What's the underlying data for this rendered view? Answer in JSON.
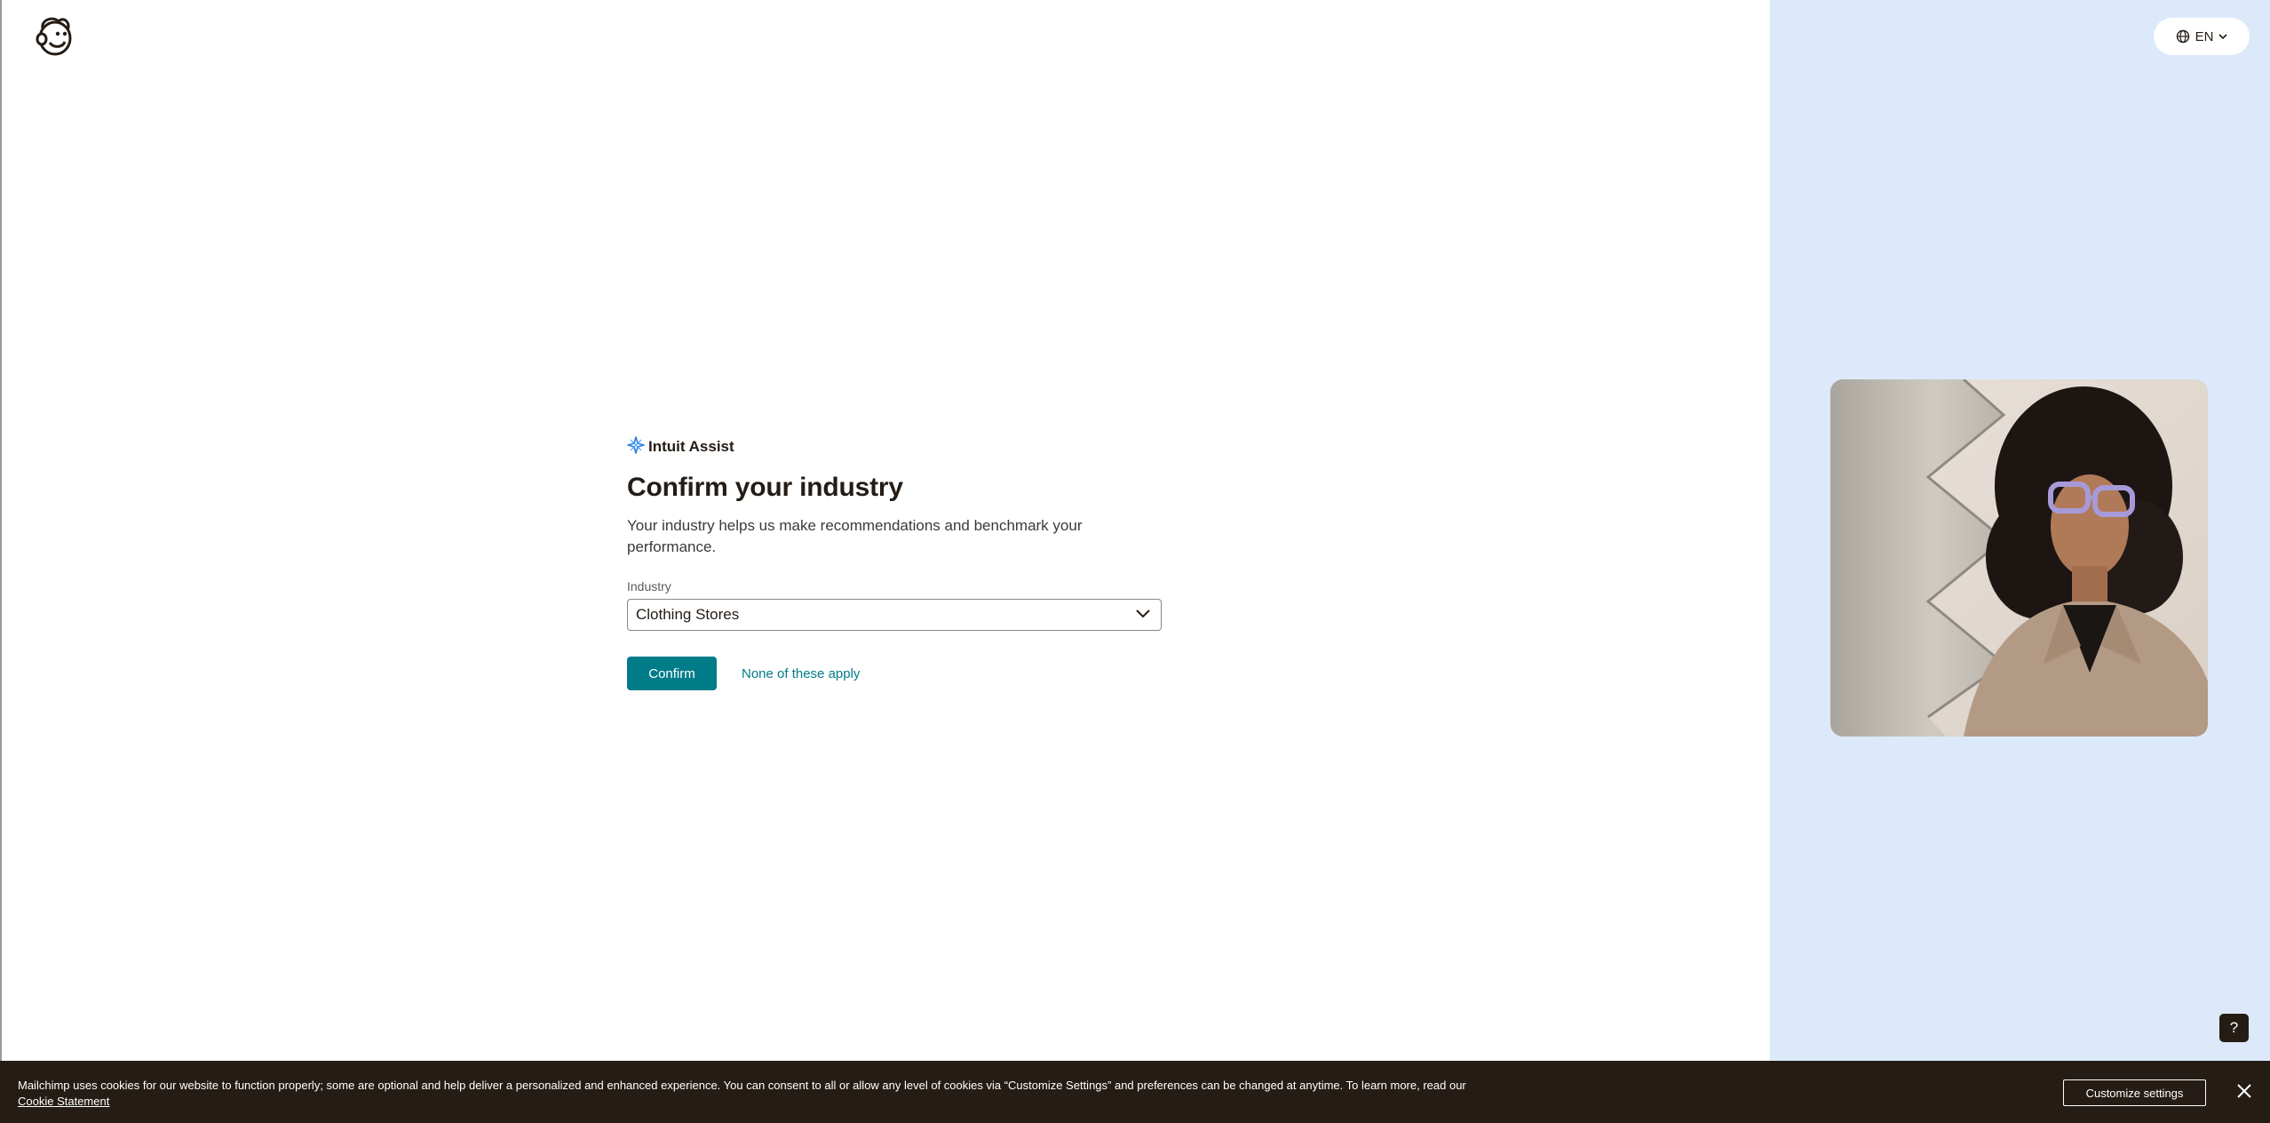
{
  "header": {
    "logo_icon": "mailchimp-freddie-logo-icon",
    "language": {
      "label": "EN",
      "icon": "globe-icon",
      "chevron_icon": "chevron-down-icon"
    }
  },
  "form": {
    "assist_icon": "sparkle-icon",
    "assist_label": "Intuit Assist",
    "title": "Confirm your industry",
    "subtitle": "Your industry helps us make recommendations and benchmark your performance.",
    "field_label": "Industry",
    "selected_value": "Clothing Stores",
    "confirm_label": "Confirm",
    "none_label": "None of these apply"
  },
  "help": {
    "label": "?"
  },
  "cookie_banner": {
    "text": "Mailchimp uses cookies for our website to function properly; some are optional and help deliver a personalized and enhanced experience. You can consent to all or allow any level of cookies via “Customize Settings” and preferences can be changed at anytime. To learn more, read our ",
    "link_label": "Cookie Statement",
    "customize_label": "Customize settings",
    "close_icon": "close-icon"
  },
  "colors": {
    "accent": "#007c89",
    "right_pane": "#dce9fb",
    "banner": "#241c15",
    "text": "#241c15"
  }
}
